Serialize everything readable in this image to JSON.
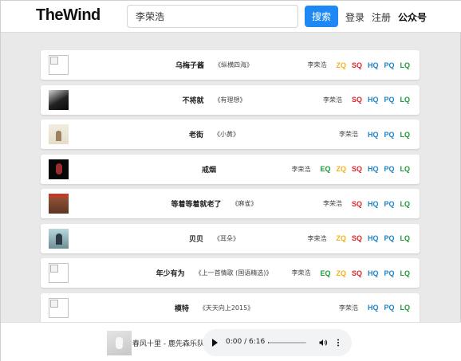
{
  "header": {
    "logo": "TheWind",
    "search_value": "李荣浩",
    "search_button": "搜索",
    "login": "登录",
    "register": "注册",
    "wechat": "公众号"
  },
  "songs": [
    {
      "title": "乌梅子酱",
      "album": "《纵横四海》",
      "artist": "李荣浩",
      "qualities": [
        "ZQ",
        "SQ",
        "HQ",
        "PQ",
        "LQ"
      ]
    },
    {
      "title": "不将就",
      "album": "《有理想》",
      "artist": "李荣浩",
      "qualities": [
        "SQ",
        "HQ",
        "PQ",
        "LQ"
      ]
    },
    {
      "title": "老街",
      "album": "《小黄》",
      "artist": "李荣浩",
      "qualities": [
        "HQ",
        "PQ",
        "LQ"
      ]
    },
    {
      "title": "戒烟",
      "album": "",
      "artist": "李荣浩",
      "qualities": [
        "EQ",
        "ZQ",
        "SQ",
        "HQ",
        "PQ",
        "LQ"
      ]
    },
    {
      "title": "等着等着就老了",
      "album": "《麻雀》",
      "artist": "李荣浩",
      "qualities": [
        "SQ",
        "HQ",
        "PQ",
        "LQ"
      ]
    },
    {
      "title": "贝贝",
      "album": "《耳朵》",
      "artist": "李荣浩",
      "qualities": [
        "ZQ",
        "SQ",
        "HQ",
        "PQ",
        "LQ"
      ]
    },
    {
      "title": "年少有为",
      "album": "《上一首情歌 (国语精选)》",
      "artist": "李荣浩",
      "qualities": [
        "EQ",
        "ZQ",
        "SQ",
        "HQ",
        "PQ",
        "LQ"
      ]
    },
    {
      "title": "模特",
      "album": "《天天向上2015》",
      "artist": "李荣浩",
      "qualities": [
        "HQ",
        "PQ",
        "LQ"
      ]
    }
  ],
  "player": {
    "now_playing": "春风十里 - 鹿先森乐队",
    "time": "0:00 / 6:16",
    "progress": 0.03
  },
  "colors": {
    "EQ": "#1c9a3a",
    "ZQ": "#f2b21c",
    "SQ": "#e2242a",
    "HQ": "#1d84c6",
    "PQ": "#1d84c6",
    "LQ": "#1c9a3a",
    "search_button": "#1e88f5"
  }
}
